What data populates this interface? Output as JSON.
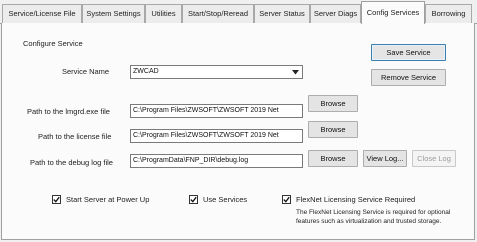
{
  "tabs": [
    {
      "label": "Service/License File",
      "active": false
    },
    {
      "label": "System Settings",
      "active": false
    },
    {
      "label": "Utilities",
      "active": false
    },
    {
      "label": "Start/Stop/Reread",
      "active": false
    },
    {
      "label": "Server Status",
      "active": false
    },
    {
      "label": "Server Diags",
      "active": false
    },
    {
      "label": "Config Services",
      "active": true
    },
    {
      "label": "Borrowing",
      "active": false
    }
  ],
  "section_title": "Configure Service",
  "service_name": {
    "label": "Service Name",
    "value": "ZWCAD"
  },
  "buttons": {
    "save": "Save Service",
    "remove": "Remove Service",
    "browse": "Browse",
    "view_log": "View Log...",
    "close_log": "Close Log"
  },
  "paths": {
    "lmgrd_label": "Path to the lmgrd.exe file",
    "lmgrd_value": "C:\\Program Files\\ZWSOFT\\ZWSOFT 2019 Net",
    "license_label": "Path to the license file",
    "license_value": "C:\\Program Files\\ZWSOFT\\ZWSOFT 2019 Net",
    "debug_label": "Path to the debug log file",
    "debug_value": "C:\\ProgramData\\FNP_DIR\\debug.log"
  },
  "checkboxes": {
    "start_server": {
      "label": "Start Server at Power Up",
      "checked": true
    },
    "use_services": {
      "label": "Use Services",
      "checked": true
    },
    "flexnet_required": {
      "label": "FlexNet Licensing Service Required",
      "checked": true
    }
  },
  "flexnet_note": "The FlexNet Licensing Service is required for optional features such as virtualization and trusted storage."
}
